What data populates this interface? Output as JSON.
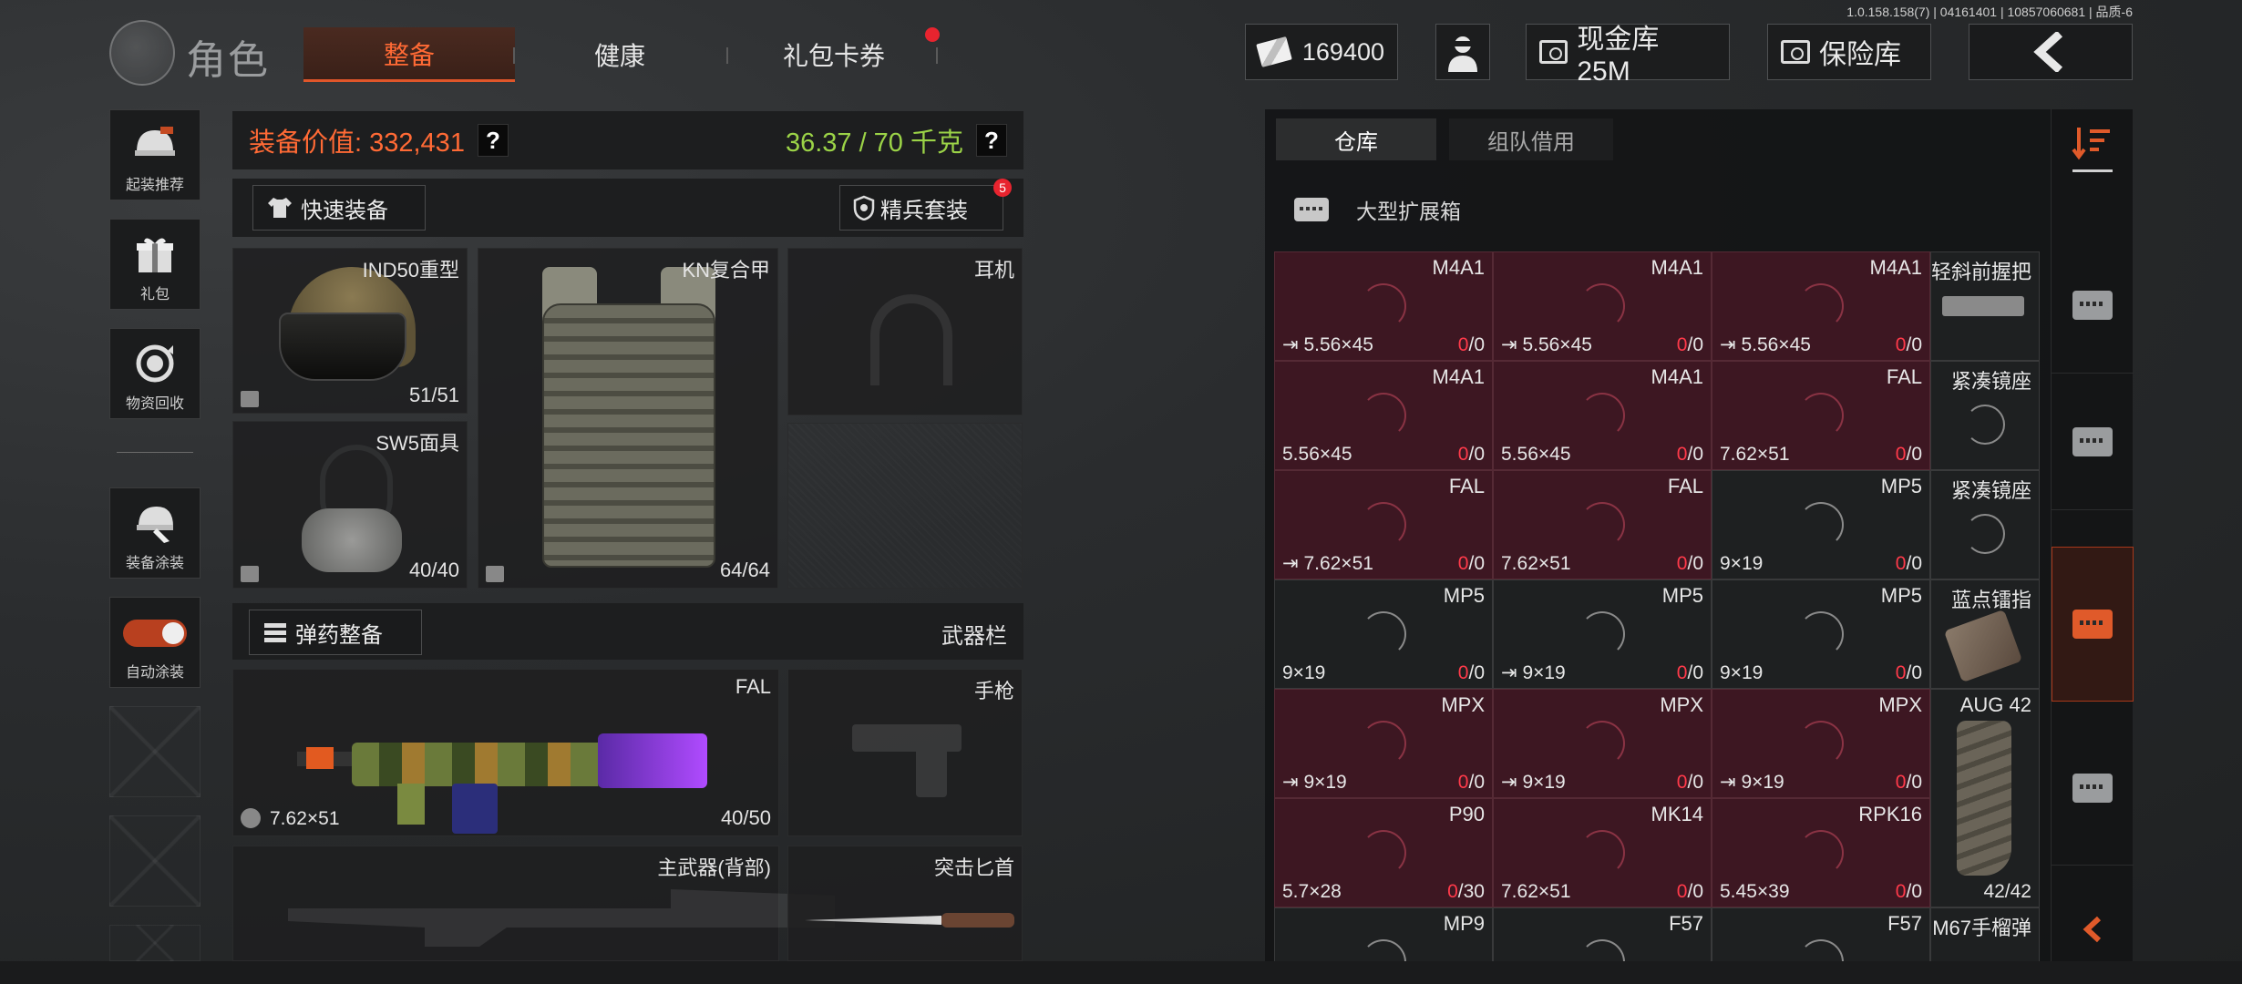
{
  "version": "1.0.158.158(7) | 04161401 | 10857060681 | 品质-6",
  "header": {
    "title": "角色",
    "tabs": [
      {
        "label": "整备",
        "active": true
      },
      {
        "label": "健康",
        "active": false
      },
      {
        "label": "礼包卡券",
        "active": false,
        "has_notification": true
      }
    ],
    "money": "169400",
    "cash_vault": "现金库 25M",
    "safe": "保险库"
  },
  "sidebar": [
    {
      "label": "起装推荐",
      "icon": "helmet-icon"
    },
    {
      "label": "礼包",
      "icon": "gift-icon"
    },
    {
      "label": "物资回收",
      "icon": "recycle-icon"
    },
    {
      "label": "装备涂装",
      "icon": "paint-icon"
    },
    {
      "label": "自动涂装",
      "icon": "toggle-icon",
      "on": true
    }
  ],
  "equipment": {
    "value_text": "装备价值: 332,431",
    "weight_text": "36.37 / 70 千克",
    "quick_equip": "快速装备",
    "elite_set": "精兵套装",
    "elite_badge": "5",
    "slots": {
      "helmet": {
        "name": "IND50重型",
        "count": "51/51"
      },
      "armor": {
        "name": "KN复合甲",
        "count": "64/64"
      },
      "headset": {
        "name": "耳机"
      },
      "mask": {
        "name": "SW5面具",
        "count": "40/40"
      }
    },
    "ammo_button": "弹药整备",
    "weapon_bar": "武器栏",
    "primary": {
      "name": "FAL",
      "caliber": "7.62×51",
      "count": "40/50"
    },
    "pistol": {
      "name": "手枪"
    },
    "secondary": {
      "name": "主武器(背部)"
    },
    "knife": {
      "name": "突击匕首"
    }
  },
  "storage": {
    "tabs": [
      "仓库",
      "组队借用"
    ],
    "container": "大型扩展箱",
    "rows": [
      [
        {
          "name": "M4A1",
          "cal": "5.56×45",
          "a": "0",
          "b": "/0",
          "red": true,
          "arrow": true
        },
        {
          "name": "M4A1",
          "cal": "5.56×45",
          "a": "0",
          "b": "/0",
          "red": true,
          "arrow": true
        },
        {
          "name": "M4A1",
          "cal": "5.56×45",
          "a": "0",
          "b": "/0",
          "red": true,
          "arrow": true
        },
        {
          "name": "轻斜前握把",
          "side": true
        }
      ],
      [
        {
          "name": "M4A1",
          "cal": "5.56×45",
          "a": "0",
          "b": "/0",
          "red": true
        },
        {
          "name": "M4A1",
          "cal": "5.56×45",
          "a": "0",
          "b": "/0",
          "red": true
        },
        {
          "name": "FAL",
          "cal": "7.62×51",
          "a": "0",
          "b": "/0",
          "red": true
        },
        {
          "name": "紧凑镜座",
          "side": true
        }
      ],
      [
        {
          "name": "FAL",
          "cal": "7.62×51",
          "a": "0",
          "b": "/0",
          "red": true,
          "arrow": true
        },
        {
          "name": "FAL",
          "cal": "7.62×51",
          "a": "0",
          "b": "/0",
          "red": true
        },
        {
          "name": "MP5",
          "cal": "9×19",
          "a": "0",
          "b": "/0",
          "red": false
        },
        {
          "name": "紧凑镜座",
          "side": true
        }
      ],
      [
        {
          "name": "MP5",
          "cal": "9×19",
          "a": "0",
          "b": "/0",
          "red": false
        },
        {
          "name": "MP5",
          "cal": "9×19",
          "a": "0",
          "b": "/0",
          "red": false,
          "arrow": true
        },
        {
          "name": "MP5",
          "cal": "9×19",
          "a": "0",
          "b": "/0",
          "red": false
        },
        {
          "name": "蓝点镭指",
          "side": true
        }
      ],
      [
        {
          "name": "MPX",
          "cal": "9×19",
          "a": "0",
          "b": "/0",
          "red": true,
          "arrow": true
        },
        {
          "name": "MPX",
          "cal": "9×19",
          "a": "0",
          "b": "/0",
          "red": true,
          "arrow": true
        },
        {
          "name": "MPX",
          "cal": "9×19",
          "a": "0",
          "b": "/0",
          "red": true,
          "arrow": true
        },
        {
          "name": "AUG 42",
          "side": true,
          "count": "42/42"
        }
      ],
      [
        {
          "name": "P90",
          "cal": "5.7×28",
          "a": "0",
          "b": "/30",
          "red": true
        },
        {
          "name": "MK14",
          "cal": "7.62×51",
          "a": "0",
          "b": "/0",
          "red": true
        },
        {
          "name": "RPK16",
          "cal": "5.45×39",
          "a": "0",
          "b": "/0",
          "red": true
        },
        {
          "name": "",
          "side": true
        }
      ],
      [
        {
          "name": "MP9",
          "cal": "",
          "a": "",
          "b": "",
          "red": false
        },
        {
          "name": "F57",
          "cal": "",
          "a": "",
          "b": "",
          "red": false
        },
        {
          "name": "F57",
          "cal": "",
          "a": "",
          "b": "",
          "red": false
        },
        {
          "name": "M67手榴弹",
          "side": true
        }
      ]
    ]
  }
}
